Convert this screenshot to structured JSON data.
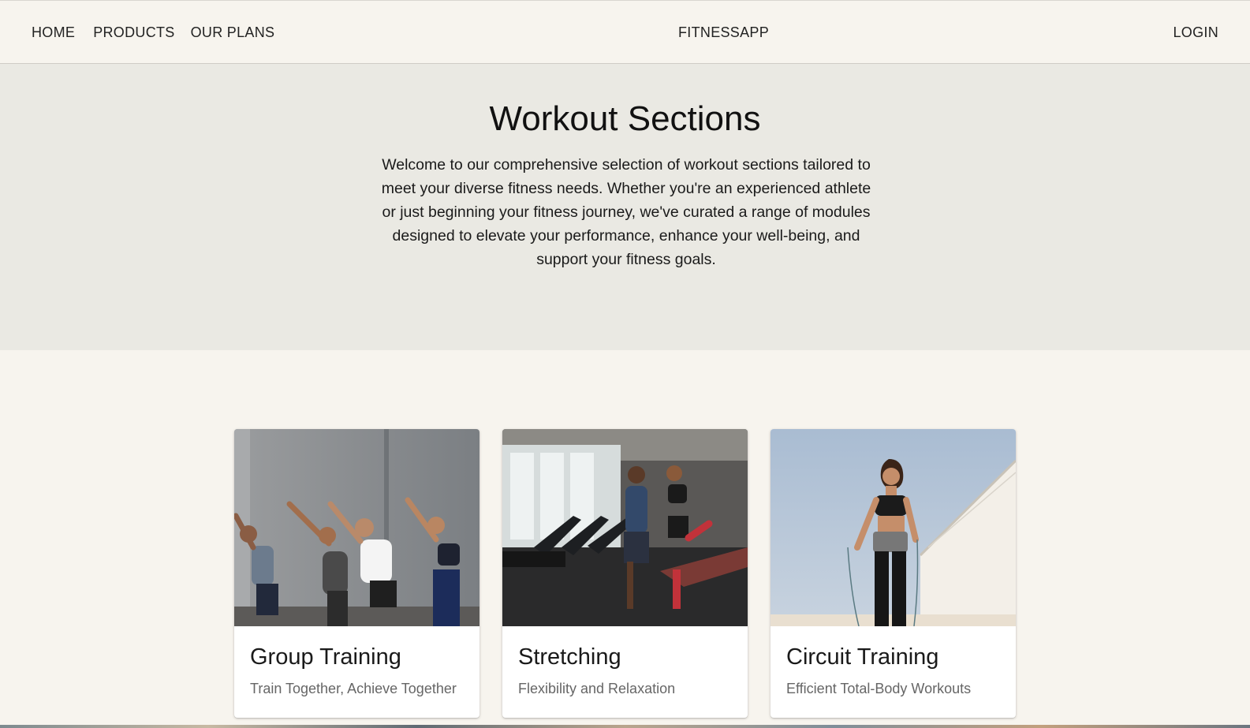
{
  "nav": {
    "home": "HOME",
    "products": "PRODUCTS",
    "plans": "OUR PLANS",
    "brand": "FITNESSAPP",
    "login": "LOGIN"
  },
  "hero": {
    "title": "Workout Sections",
    "text": "Welcome to our comprehensive selection of workout sections tailored to meet your diverse fitness needs. Whether you're an experienced athlete or just beginning your fitness journey, we've curated a range of modules designed to elevate your performance, enhance your well-being, and support your fitness goals."
  },
  "cards": [
    {
      "title": "Group Training",
      "subtitle": "Train Together, Achieve Together",
      "image": "group-stretching-photo"
    },
    {
      "title": "Stretching",
      "subtitle": "Flexibility and Relaxation",
      "image": "partner-stretching-gym-photo"
    },
    {
      "title": "Circuit Training",
      "subtitle": "Efficient Total-Body Workouts",
      "image": "jump-rope-woman-photo"
    }
  ],
  "colors": {
    "page_bg": "#f7f4ee",
    "hero_bg": "#eae9e3",
    "card_bg": "#ffffff",
    "subtitle": "#666666"
  }
}
